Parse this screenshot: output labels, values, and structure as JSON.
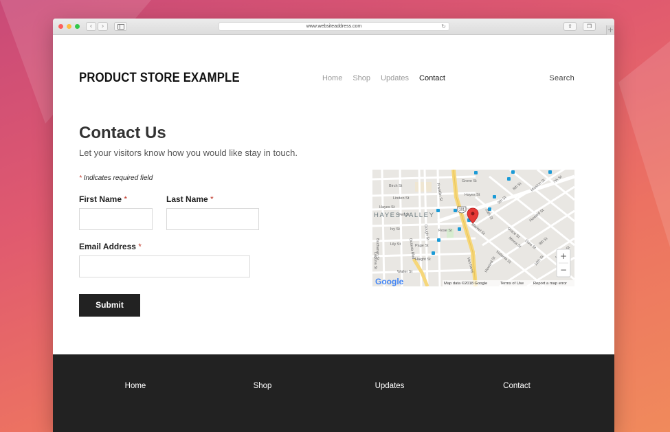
{
  "browser": {
    "url": "www.websiteaddress.com",
    "back_icon": "chevron-left-icon",
    "forward_icon": "chevron-right-icon",
    "sidebar_icon": "sidebar-icon",
    "reload_icon": "reload-icon",
    "share_icon": "share-icon",
    "tabs_icon": "tabs-icon",
    "new_tab_icon": "plus-icon"
  },
  "header": {
    "logo": "PRODUCT STORE EXAMPLE",
    "nav": [
      {
        "label": "Home",
        "active": false
      },
      {
        "label": "Shop",
        "active": false
      },
      {
        "label": "Updates",
        "active": false
      },
      {
        "label": "Contact",
        "active": true
      }
    ],
    "search": "Search"
  },
  "content": {
    "title": "Contact Us",
    "subtitle": "Let your visitors know how you would like stay in touch.",
    "required_mark": "*",
    "required_note": "Indicates required field"
  },
  "form": {
    "first_name_label": "First Name",
    "last_name_label": "Last Name",
    "email_label": "Email Address",
    "first_name_value": "",
    "last_name_value": "",
    "email_value": "",
    "submit_label": "Submit"
  },
  "map": {
    "neighborhood": "HAYES VALLEY",
    "streets": [
      "Birch St",
      "Grove St",
      "Hayes St",
      "Hayes St",
      "Linden St",
      "Ivy St",
      "Lily St",
      "Rose St",
      "Page St",
      "Haight St",
      "Waller St",
      "Laguna St",
      "Buchanan St",
      "Franklin St",
      "Gough St",
      "Octavia Blvd",
      "Mission St",
      "7th St",
      "8th St",
      "9th St",
      "9th St",
      "10th St",
      "10th St",
      "Howard St",
      "Howard St",
      "Grace St",
      "Dore St",
      "Minna St",
      "Natoma St",
      "Market St",
      "Fell St",
      "Van Ness",
      "Mission St"
    ],
    "highway": "101",
    "zoom_in": "+",
    "zoom_out": "−",
    "brand": "Google",
    "attribution": "Map data ©2018 Google",
    "terms": "Terms of Use",
    "report": "Report a map error",
    "marker_icon": "map-pin-icon",
    "transit_icon": "transit-icon"
  },
  "footer": {
    "links": [
      "Home",
      "Shop",
      "Updates",
      "Contact"
    ]
  },
  "colors": {
    "accent_required": "#c0392b",
    "button_bg": "#222222",
    "footer_bg": "#222222",
    "map_marker": "#e53935",
    "freeway": "#f6d77a"
  }
}
